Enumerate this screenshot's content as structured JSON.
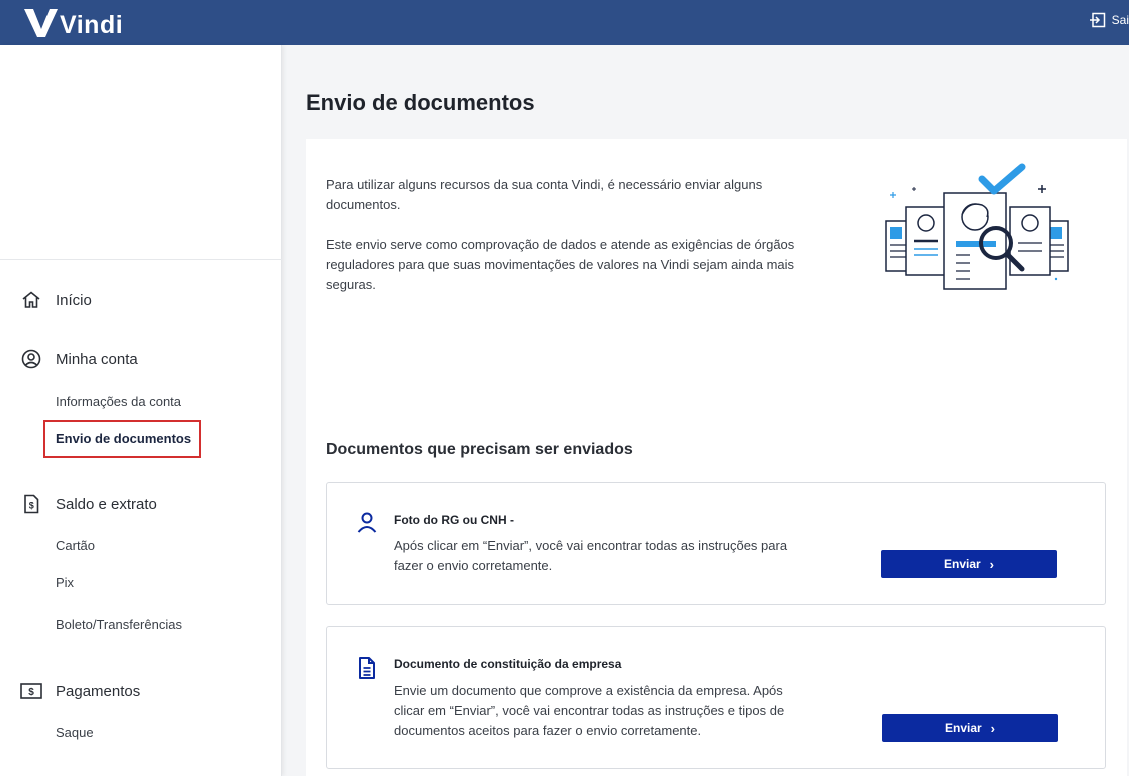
{
  "header": {
    "logo_text": "Vindi",
    "logout_label": "Sair"
  },
  "sidebar": {
    "items": [
      {
        "label": "Início",
        "icon": "home-icon"
      },
      {
        "label": "Minha conta",
        "icon": "user-circle-icon",
        "subitems": [
          "Informações da conta",
          "Envio de documentos"
        ]
      },
      {
        "label": "Saldo e extrato",
        "icon": "dollar-document-icon",
        "subitems": [
          "Cartão",
          "Pix",
          "Boleto/Transferências"
        ]
      },
      {
        "label": "Pagamentos",
        "icon": "dollar-bill-icon",
        "subitems": [
          "Saque"
        ]
      }
    ],
    "active_item": "Envio de documentos"
  },
  "main": {
    "title": "Envio de documentos",
    "intro_paragraphs": [
      "Para utilizar alguns recursos da sua conta Vindi, é necessário enviar alguns documentos.",
      "Este envio serve como comprovação de dados e atende as exigências de órgãos reguladores para que suas movimentações de valores na Vindi sejam ainda mais seguras."
    ],
    "section_title": "Documentos que precisam ser enviados",
    "documents": [
      {
        "title": "Foto do RG ou CNH -",
        "description": "Após clicar em “Enviar”, você vai encontrar todas as instruções para fazer o envio corretamente.",
        "button_label": "Enviar",
        "icon": "person-icon"
      },
      {
        "title": "Documento de constituição da empresa",
        "description": "Envie um documento que comprove a existência da empresa. Após clicar em “Enviar”, você vai encontrar todas as instruções e tipos de documentos aceitos para fazer o envio corretamente.",
        "button_label": "Enviar",
        "icon": "document-icon"
      }
    ]
  },
  "colors": {
    "header_bg": "#2e4e87",
    "button_bg": "#0b2aa0",
    "active_outline": "#d32f2f",
    "accent_blue": "#2e9be6"
  }
}
